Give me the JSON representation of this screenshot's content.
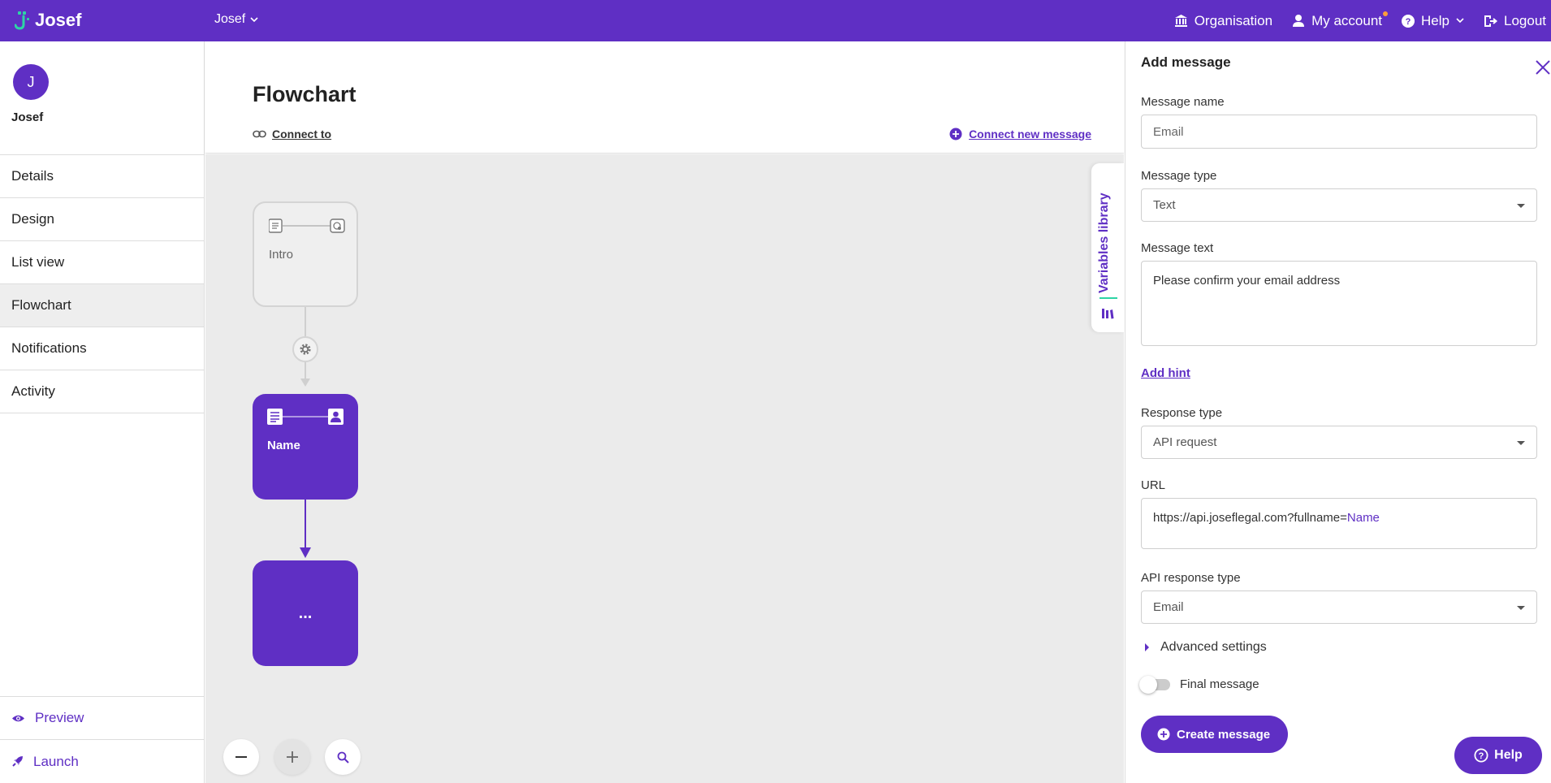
{
  "topbar": {
    "logo_text": "Josef",
    "project": "Josef",
    "nav": {
      "organisation": "Organisation",
      "my_account": "My account",
      "help": "Help",
      "logout": "Logout"
    }
  },
  "sidebar": {
    "avatar_initial": "J",
    "user_name": "Josef",
    "items": [
      {
        "label": "Details"
      },
      {
        "label": "Design"
      },
      {
        "label": "List view"
      },
      {
        "label": "Flowchart"
      },
      {
        "label": "Notifications"
      },
      {
        "label": "Activity"
      }
    ],
    "active": "Flowchart",
    "bottom": {
      "preview": "Preview",
      "launch": "Launch"
    }
  },
  "main": {
    "title": "Flowchart",
    "connect_to": "Connect to",
    "connect_new": "Connect new message"
  },
  "canvas": {
    "nodes": [
      {
        "label": "Intro"
      },
      {
        "label": "Name"
      },
      {
        "label": "..."
      }
    ],
    "variables_tab": "Variables library"
  },
  "panel": {
    "title": "Add message",
    "message_name_label": "Message name",
    "message_name_placeholder": "Email",
    "message_type_label": "Message type",
    "message_type_value": "Text",
    "message_text_label": "Message text",
    "message_text_value": "Please confirm your email address",
    "add_hint": "Add hint",
    "response_type_label": "Response type",
    "response_type_value": "API request",
    "url_label": "URL",
    "url_prefix": "https://api.joseflegal.com?fullname=",
    "url_variable": "Name",
    "api_response_type_label": "API response type",
    "api_response_type_value": "Email",
    "advanced_settings": "Advanced settings",
    "final_message": "Final message",
    "final_message_on": false,
    "create_button": "Create message"
  },
  "help_button": "Help",
  "colors": {
    "brand": "#5f2fc4",
    "accent": "#2dd4a5",
    "canvas_bg": "#ebebeb",
    "notification_dot": "#ff9d3b"
  }
}
